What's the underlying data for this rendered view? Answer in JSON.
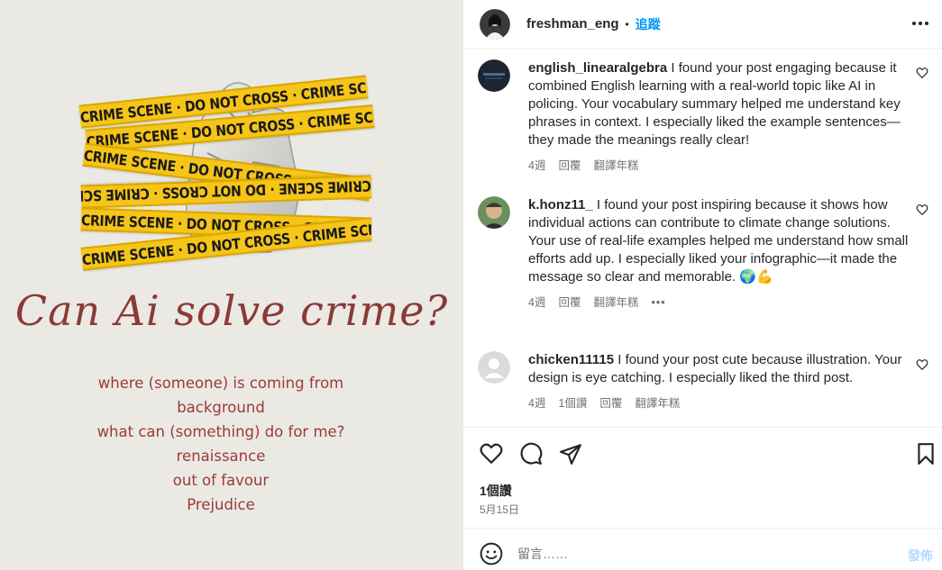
{
  "poster": {
    "tape_text": "CRIME SCENE · DO NOT CROSS · CRIME SCENE · DO NOT CROSS",
    "title": "Can Ai solve crime?",
    "list": [
      "where (someone) is coming from",
      "background",
      "what can (something) do for me?",
      "renaissance",
      "out of favour",
      "Prejudice"
    ],
    "tape_color": "#f5c518",
    "text_color": "#8b3a36"
  },
  "header": {
    "username": "freshman_eng",
    "separator": "•",
    "follow_label": "追蹤",
    "more_icon": "more-horizontal-icon"
  },
  "comments": [
    {
      "username": "english_linearalgebra",
      "text": "I found your post engaging because it combined English learning with a real-world topic like AI in policing. Your vocabulary summary helped me understand key phrases in context. I especially liked the example sentences—they made the meanings really clear!",
      "time": "4週",
      "reply_label": "回覆",
      "translate_label": "翻譯年糕"
    },
    {
      "username": "k.honz11_",
      "text": "I found your post inspiring because it shows how individual actions can contribute to climate change solutions. Your use of real-life examples helped me understand how small efforts add up. I especially liked your infographic—it made the message so clear and memorable. 🌍💪",
      "time": "4週",
      "reply_label": "回覆",
      "translate_label": "翻譯年糕",
      "more_label": "•••"
    },
    {
      "username": "chicken11115",
      "text": "I found your post cute because illustration. Your design is eye catching. I especially liked the third post.",
      "time": "4週",
      "likes_label": "1個讚",
      "reply_label": "回覆",
      "translate_label": "翻譯年糕"
    }
  ],
  "actions": {
    "like_icon": "heart-icon",
    "comment_icon": "comment-icon",
    "share_icon": "share-icon",
    "save_icon": "bookmark-icon"
  },
  "likes": "1個讚",
  "date": "5月15日",
  "compose": {
    "placeholder": "留言……",
    "post_label": "發佈",
    "post_color": "#b3dbff"
  },
  "colors": {
    "accent": "#0095f6",
    "secondary_text": "#737373",
    "border": "#efefef"
  }
}
